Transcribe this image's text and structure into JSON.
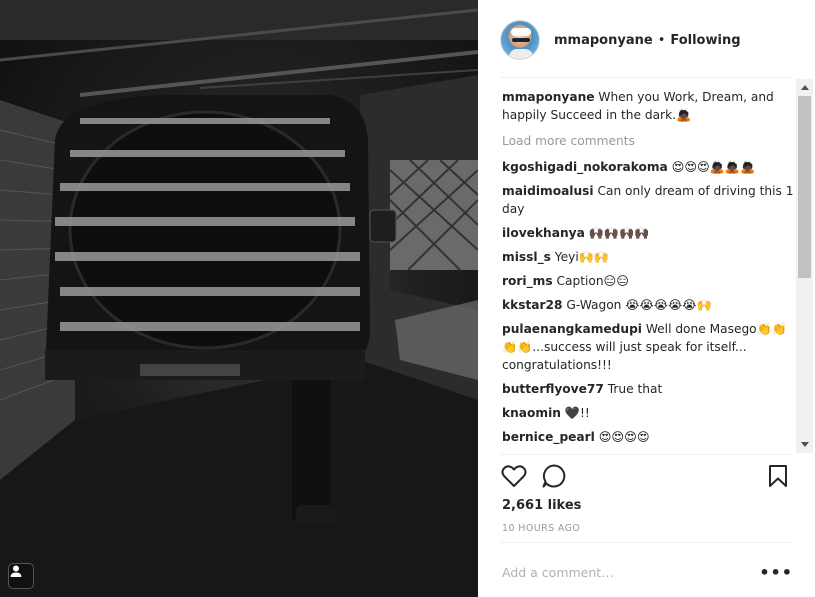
{
  "post": {
    "username": "mmaponyane",
    "separator": "•",
    "follow_status": "Following",
    "caption_user": "mmaponyane",
    "caption_text": "When you Work, Dream, and happily Succeed in the dark.🙇🏿"
  },
  "load_more": "Load more comments",
  "comments": [
    {
      "user": "kgoshigadi_nokorakoma",
      "text": "😍😍😍🙇🏿🙇🏿🙇🏿"
    },
    {
      "user": "maidimoalusi",
      "text": "Can only dream of driving this 1 day"
    },
    {
      "user": "ilovekhanya",
      "text": "🙌🏿🙌🏿🙌🏿🙌🏿"
    },
    {
      "user": "missl_s",
      "text": "Yeyi🙌🙌"
    },
    {
      "user": "rori_ms",
      "text": "Caption😑😑"
    },
    {
      "user": "kkstar28",
      "text": "G-Wagon 😭😭😭😭😭🙌"
    },
    {
      "user": "pulaenangkamedupi",
      "text": "Well done Masego👏👏👏👏...success will just speak for itself... congratulations!!!"
    },
    {
      "user": "butterflyove77",
      "text": "True that"
    },
    {
      "user": "knaomin",
      "text": "🖤!!"
    },
    {
      "user": "bernice_pearl",
      "text": "😍😍😍😍"
    }
  ],
  "likes": "2,661 likes",
  "time": "10 HOURS AGO",
  "add_comment_placeholder": "Add a comment…",
  "more_label": "•••",
  "icons": {
    "like": "heart-icon",
    "comment": "comment-bubble-icon",
    "save": "bookmark-icon",
    "tag": "user-tag-icon"
  }
}
